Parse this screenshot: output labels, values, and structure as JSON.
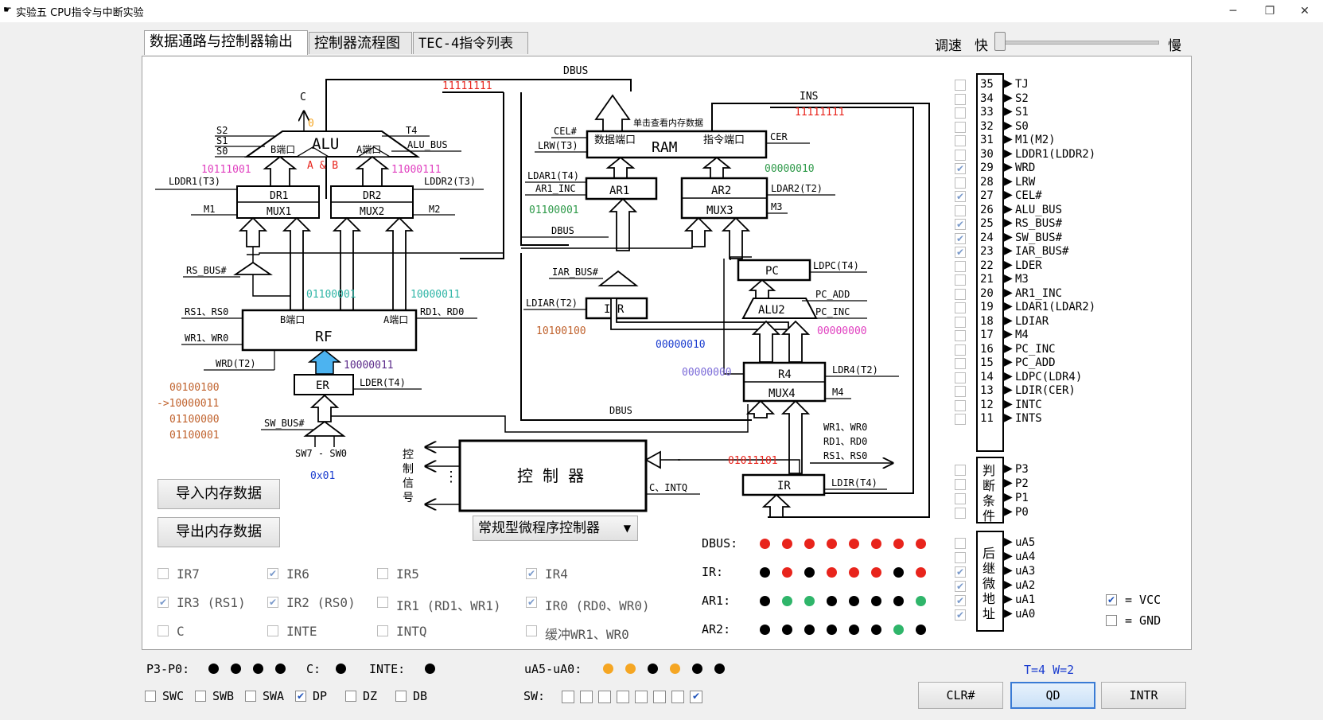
{
  "window": {
    "title": "实验五 CPU指令与中断实验"
  },
  "tabs": [
    "数据通路与控制器输出",
    "控制器流程图",
    "TEC-4指令列表"
  ],
  "speed": {
    "label": "调速",
    "fast": "快",
    "slow": "慢"
  },
  "diagram": {
    "dbus_top": "DBUS",
    "dbus_top_val": "11111111",
    "ins": "INS",
    "ins_val": "11111111",
    "c_label": "C",
    "c_val": "0",
    "alu": "ALU",
    "alu_op": "A & B",
    "alu_bport": "B端口",
    "alu_aport": "A端口",
    "s2": "S2",
    "s1": "S1",
    "s0": "S0",
    "t4": "T4",
    "alu_bus": "ALU_BUS",
    "val_b": "10111001",
    "val_a": "11000111",
    "lddr1": "LDDR1(T3)",
    "lddr2": "LDDR2(T3)",
    "dr1": "DR1",
    "mux1": "MUX1",
    "dr2": "DR2",
    "mux2": "MUX2",
    "m1": "M1",
    "m2": "M2",
    "rs_bus": "RS_BUS#",
    "rf_b_val": "01100001",
    "rf_a_val": "10000011",
    "rs": "RS1、RS0",
    "rd": "RD1、RD0",
    "wr": "WR1、WR0",
    "rf": "RF",
    "rf_bport": "B端口",
    "rf_aport": "A端口",
    "wrd": "WRD(T2)",
    "er": "ER",
    "er_val": "10000011",
    "lder": "LDER(T4)",
    "hist": [
      "00100100",
      "->10000011",
      "01100000",
      "01100001"
    ],
    "sw_bus": "SW_BUS#",
    "sw_range": "SW7 - SW0",
    "sw_val": "0x01",
    "cel": "CEL#",
    "lrw": "LRW(T3)",
    "ram": "RAM",
    "data_port": "数据端口",
    "instr_port": "指令端口",
    "ram_hint": "单击查看内存数据",
    "cer": "CER",
    "ldar1": "LDAR1(T4)",
    "ar1_inc": "AR1_INC",
    "ar1": "AR1",
    "ar1_val": "01100001",
    "dbus_mid": "DBUS",
    "ar2": "AR2",
    "mux3": "MUX3",
    "ldar2": "LDAR2(T2)",
    "m3": "M3",
    "ar2_val": "00000010",
    "iar_bus": "IAR_BUS#",
    "ldiar": "LDIAR(T2)",
    "iar": "IAR",
    "iar_val": "10100100",
    "pc": "PC",
    "ldpc": "LDPC(T4)",
    "alu2": "ALU2",
    "pc_add": "PC_ADD",
    "pc_inc": "PC_INC",
    "pc_val": "00000010",
    "alu2_val": "00000000",
    "r4": "R4",
    "mux4": "MUX4",
    "ldr4": "LDR4(T2)",
    "m4": "M4",
    "r4_val": "00000000",
    "dbus_bottom": "DBUS",
    "ctrl": "控 制 器",
    "ctrl_sig": [
      "控",
      "制",
      "信",
      "号"
    ],
    "dots": "⋮",
    "c_intq": "C、INTQ",
    "ir_val": "01011101",
    "ir": "IR",
    "ldir": "LDIR(T4)",
    "ir_out": [
      "WR1、WR0",
      "RD1、RD0",
      "RS1、RS0"
    ]
  },
  "controller_select": "常规型微程序控制器",
  "buttons": {
    "import": "导入内存数据",
    "export": "导出内存数据",
    "clr": "CLR#",
    "qd": "QD",
    "intr": "INTR"
  },
  "ir_checks": [
    {
      "label": "IR7",
      "checked": false
    },
    {
      "label": "IR6",
      "checked": true
    },
    {
      "label": "IR5",
      "checked": false
    },
    {
      "label": "IR4",
      "checked": true
    },
    {
      "label": "IR3 (RS1)",
      "checked": true
    },
    {
      "label": "IR2 (RS0)",
      "checked": true
    },
    {
      "label": "IR1 (RD1、WR1)",
      "checked": false
    },
    {
      "label": "IR0 (RD0、WR0)",
      "checked": true
    },
    {
      "label": "C",
      "checked": false
    },
    {
      "label": "INTE",
      "checked": false
    },
    {
      "label": "INTQ",
      "checked": false
    },
    {
      "label": "缓冲WR1、WR0",
      "checked": false
    }
  ],
  "bus_leds": {
    "colors": {
      "on": "#e8241c",
      "off": "#000000",
      "green": "#2fb56a",
      "orange": "#f5a623"
    },
    "rows": [
      {
        "label": "DBUS:",
        "bits": [
          1,
          1,
          1,
          1,
          1,
          1,
          1,
          1
        ]
      },
      {
        "label": "IR:",
        "bits": [
          0,
          1,
          0,
          1,
          1,
          1,
          0,
          1
        ]
      },
      {
        "label": "AR1:",
        "bits": [
          0,
          2,
          2,
          0,
          0,
          0,
          0,
          2
        ]
      },
      {
        "label": "AR2:",
        "bits": [
          0,
          0,
          0,
          0,
          0,
          0,
          2,
          0
        ]
      }
    ]
  },
  "signals": [
    {
      "num": "35",
      "name": "TJ",
      "checked": false
    },
    {
      "num": "34",
      "name": "S2",
      "checked": false
    },
    {
      "num": "33",
      "name": "S1",
      "checked": false
    },
    {
      "num": "32",
      "name": "S0",
      "checked": false
    },
    {
      "num": "31",
      "name": "M1(M2)",
      "checked": false
    },
    {
      "num": "30",
      "name": "LDDR1(LDDR2)",
      "checked": false
    },
    {
      "num": "29",
      "name": "WRD",
      "checked": true
    },
    {
      "num": "28",
      "name": "LRW",
      "checked": false
    },
    {
      "num": "27",
      "name": "CEL#",
      "checked": true
    },
    {
      "num": "26",
      "name": "ALU_BUS",
      "checked": false
    },
    {
      "num": "25",
      "name": "RS_BUS#",
      "checked": true
    },
    {
      "num": "24",
      "name": "SW_BUS#",
      "checked": true
    },
    {
      "num": "23",
      "name": "IAR_BUS#",
      "checked": true
    },
    {
      "num": "22",
      "name": "LDER",
      "checked": false
    },
    {
      "num": "21",
      "name": "M3",
      "checked": false
    },
    {
      "num": "20",
      "name": "AR1_INC",
      "checked": false
    },
    {
      "num": "19",
      "name": "LDAR1(LDAR2)",
      "checked": false
    },
    {
      "num": "18",
      "name": "LDIAR",
      "checked": false
    },
    {
      "num": "17",
      "name": "M4",
      "checked": false
    },
    {
      "num": "16",
      "name": "PC_INC",
      "checked": false
    },
    {
      "num": "15",
      "name": "PC_ADD",
      "checked": false
    },
    {
      "num": "14",
      "name": "LDPC(LDR4)",
      "checked": false
    },
    {
      "num": "13",
      "name": "LDIR(CER)",
      "checked": false
    },
    {
      "num": "12",
      "name": "INTC",
      "checked": false
    },
    {
      "num": "11",
      "name": "INTS",
      "checked": false
    }
  ],
  "cond_group": {
    "title": [
      "判",
      "断",
      "条",
      "件"
    ],
    "items": [
      {
        "name": "P3",
        "checked": false
      },
      {
        "name": "P2",
        "checked": false
      },
      {
        "name": "P1",
        "checked": false
      },
      {
        "name": "P0",
        "checked": false
      }
    ]
  },
  "next_group": {
    "title": [
      "后",
      "继",
      "微",
      "地",
      "址"
    ],
    "items": [
      {
        "name": "uA5",
        "checked": false
      },
      {
        "name": "uA4",
        "checked": false
      },
      {
        "name": "uA3",
        "checked": true
      },
      {
        "name": "uA2",
        "checked": true
      },
      {
        "name": "uA1",
        "checked": true
      },
      {
        "name": "uA0",
        "checked": true
      }
    ]
  },
  "legend": [
    {
      "label": "= VCC",
      "checked": true
    },
    {
      "label": "= GND",
      "checked": false
    }
  ],
  "status": {
    "p_label": "P3-P0:",
    "p_bits": [
      0,
      0,
      0,
      0
    ],
    "c_label": "C:",
    "c_bits": [
      0
    ],
    "inte_label": "INTE:",
    "inte_bits": [
      0
    ],
    "ua_label": "uA5-uA0:",
    "ua_bits": [
      3,
      3,
      0,
      3,
      0,
      0
    ],
    "timing": "T=4 W=2"
  },
  "switches": [
    {
      "label": "SWC",
      "checked": false
    },
    {
      "label": "SWB",
      "checked": false
    },
    {
      "label": "SWA",
      "checked": false
    },
    {
      "label": "DP",
      "checked": true
    },
    {
      "label": "DZ",
      "checked": false
    },
    {
      "label": "DB",
      "checked": false
    }
  ],
  "sw": {
    "label": "SW:",
    "bits": [
      0,
      0,
      0,
      0,
      0,
      0,
      0,
      1
    ]
  }
}
